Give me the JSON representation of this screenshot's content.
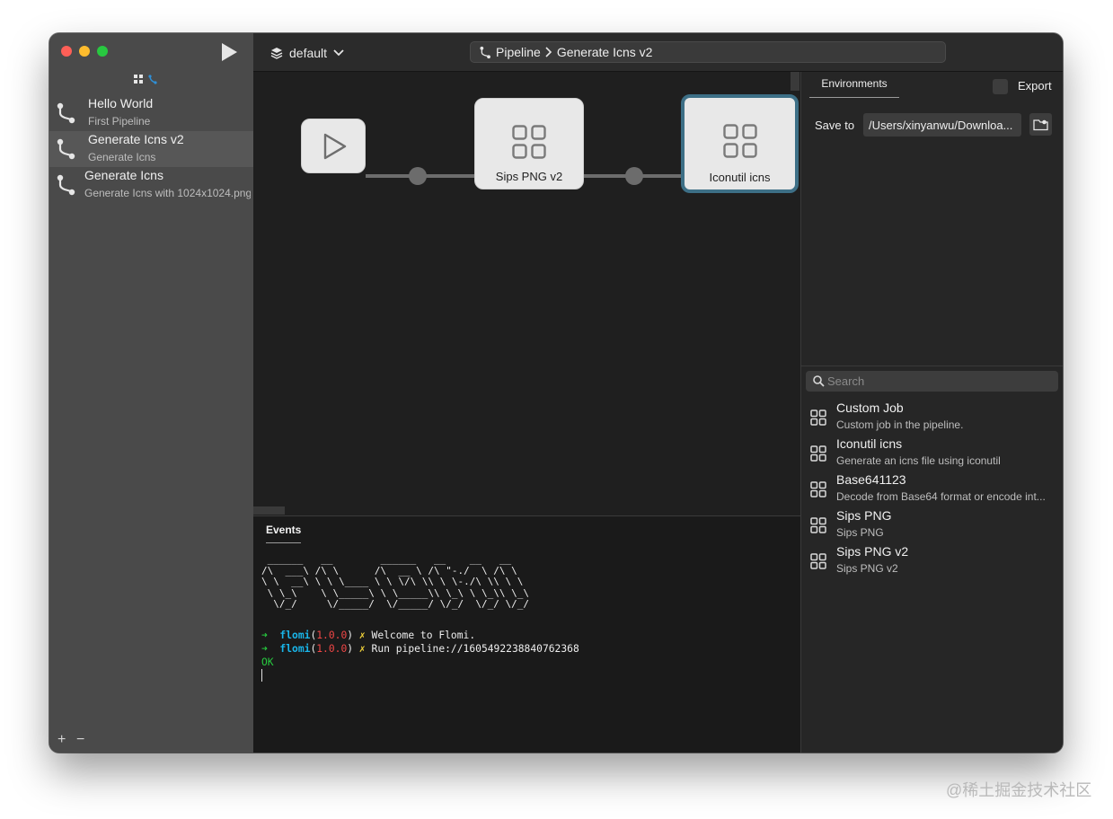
{
  "sidebar": {
    "pipelines": [
      {
        "name": "Hello World",
        "description": "First Pipeline"
      },
      {
        "name": "Generate Icns v2",
        "description": "Generate Icns"
      },
      {
        "name": "Generate Icns",
        "description": "Generate Icns with 1024x1024.png"
      }
    ],
    "add_label": "+",
    "remove_label": "−"
  },
  "toolbar": {
    "workspace": "default",
    "breadcrumb": {
      "root": "Pipeline",
      "current": "Generate Icns v2"
    }
  },
  "canvas": {
    "nodes": [
      {
        "label": "Sips PNG v2"
      },
      {
        "label": "Iconutil icns"
      }
    ]
  },
  "events": {
    "tab_label": "Events",
    "ascii_art": " ______   __        ______   __    __   __\n/\\  ___\\ /\\ \\      /\\  __ \\ /\\ \"-./  \\ /\\ \\\n\\ \\  __\\ \\ \\ \\____ \\ \\ \\/\\ \\\\ \\ \\-./\\ \\\\ \\ \\\n \\ \\_\\    \\ \\_____\\ \\ \\_____\\\\ \\_\\ \\ \\_\\\\ \\_\\\n  \\/_/     \\/_____/  \\/_____/ \\/_/  \\/_/ \\/_/",
    "lines": [
      {
        "arrow": "➜",
        "name": "flomi",
        "version": "1.0.0",
        "mark": "✗",
        "message": "Welcome to Flomi."
      },
      {
        "arrow": "➜",
        "name": "flomi",
        "version": "1.0.0",
        "mark": "✗",
        "message": "Run pipeline://1605492238840762368"
      }
    ],
    "status": "OK"
  },
  "right_panel": {
    "tab": "Environments",
    "export_label": "Export",
    "save_to_label": "Save to",
    "save_to_value": "/Users/xinyanwu/Downloa...",
    "search_placeholder": "Search",
    "jobs": [
      {
        "name": "Custom Job",
        "description": "Custom job in the pipeline."
      },
      {
        "name": "Iconutil icns",
        "description": "Generate an icns file using iconutil"
      },
      {
        "name": "Base641123",
        "description": "Decode from Base64 format or encode int..."
      },
      {
        "name": "Sips PNG",
        "description": "Sips PNG"
      },
      {
        "name": "Sips PNG v2",
        "description": "Sips PNG v2"
      }
    ]
  },
  "watermark": "@稀土掘金技术社区",
  "icons": {
    "run": "play-icon",
    "pipeline": "pipeline-branch-icon",
    "job": "grid-icon",
    "workspace": "layers-icon",
    "search": "search-icon",
    "folder": "folder-icon"
  },
  "colors": {
    "accent": "#3d6f86",
    "terminal_green": "#27c93f",
    "terminal_cyan": "#19b6ea",
    "terminal_red": "#f04646",
    "terminal_yellow": "#f0d13a"
  }
}
